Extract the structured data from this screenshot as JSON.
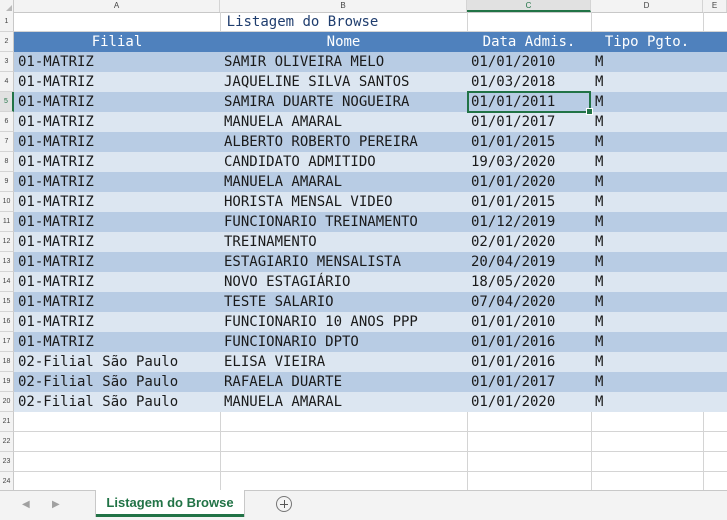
{
  "column_headers": [
    "A",
    "B",
    "C",
    "D",
    "E"
  ],
  "selected_column": "C",
  "selected_row": 5,
  "row_numbers": [
    "1",
    "2",
    "3",
    "4",
    "5",
    "6",
    "7",
    "8",
    "9",
    "10",
    "11",
    "12",
    "13",
    "14",
    "15",
    "16",
    "17",
    "18",
    "19",
    "20",
    "21",
    "22",
    "23",
    "24"
  ],
  "sheet": {
    "title": "Listagem do Browse",
    "headers": [
      "Filial",
      "Nome",
      "Data Admis.",
      "Tipo Pgto."
    ],
    "rows": [
      {
        "filial": "01-MATRIZ",
        "nome": "SAMIR OLIVEIRA MELO",
        "data": "01/01/2010",
        "tipo": "M"
      },
      {
        "filial": "01-MATRIZ",
        "nome": "JAQUELINE SILVA SANTOS",
        "data": "01/03/2018",
        "tipo": "M"
      },
      {
        "filial": "01-MATRIZ",
        "nome": "SAMIRA DUARTE NOGUEIRA",
        "data": "01/01/2011",
        "tipo": "M"
      },
      {
        "filial": "01-MATRIZ",
        "nome": "MANUELA AMARAL",
        "data": "01/01/2017",
        "tipo": "M"
      },
      {
        "filial": "01-MATRIZ",
        "nome": "ALBERTO ROBERTO PEREIRA",
        "data": "01/01/2015",
        "tipo": "M"
      },
      {
        "filial": "01-MATRIZ",
        "nome": "CANDIDATO ADMITIDO",
        "data": "19/03/2020",
        "tipo": "M"
      },
      {
        "filial": "01-MATRIZ",
        "nome": "MANUELA AMARAL",
        "data": "01/01/2020",
        "tipo": "M"
      },
      {
        "filial": "01-MATRIZ",
        "nome": "HORISTA MENSAL VIDEO",
        "data": "01/01/2015",
        "tipo": "M"
      },
      {
        "filial": "01-MATRIZ",
        "nome": "FUNCIONARIO TREINAMENTO",
        "data": "01/12/2019",
        "tipo": "M"
      },
      {
        "filial": "01-MATRIZ",
        "nome": "TREINAMENTO",
        "data": "02/01/2020",
        "tipo": "M"
      },
      {
        "filial": "01-MATRIZ",
        "nome": "ESTAGIARIO MENSALISTA",
        "data": "20/04/2019",
        "tipo": "M"
      },
      {
        "filial": "01-MATRIZ",
        "nome": "NOVO ESTAGIÁRIO",
        "data": "18/05/2020",
        "tipo": "M"
      },
      {
        "filial": "01-MATRIZ",
        "nome": "TESTE SALARIO",
        "data": "07/04/2020",
        "tipo": "M"
      },
      {
        "filial": "01-MATRIZ",
        "nome": "FUNCIONARIO 10 ANOS PPP",
        "data": "01/01/2010",
        "tipo": "M"
      },
      {
        "filial": "01-MATRIZ",
        "nome": "FUNCIONARIO DPTO",
        "data": "01/01/2016",
        "tipo": "M"
      },
      {
        "filial": "02-Filial São Paulo",
        "nome": "ELISA VIEIRA",
        "data": "01/01/2016",
        "tipo": "M"
      },
      {
        "filial": "02-Filial São Paulo",
        "nome": "RAFAELA DUARTE",
        "data": "01/01/2017",
        "tipo": "M"
      },
      {
        "filial": "02-Filial São Paulo",
        "nome": "MANUELA AMARAL",
        "data": "01/01/2020",
        "tipo": "M"
      }
    ]
  },
  "tabs": [
    {
      "label": "Listagem do Browse",
      "active": true
    }
  ],
  "icons": {
    "scroll_left": "chevron-left-icon",
    "scroll_right": "chevron-right-icon",
    "add_sheet": "plus-circle-icon"
  },
  "colors": {
    "header_fill": "#4f81bd",
    "band_dark": "#b8cce4",
    "band_light": "#dce6f1",
    "accent": "#217346",
    "title_text": "#1f3d6e"
  }
}
